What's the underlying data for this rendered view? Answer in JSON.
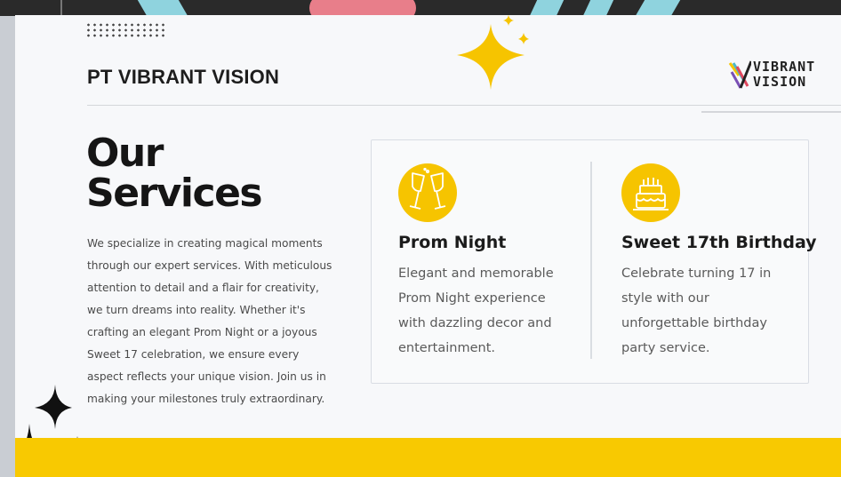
{
  "header": {
    "company": "PT VIBRANT VISION",
    "logo_line1": "VIBRANT",
    "logo_line2": "VISION"
  },
  "main": {
    "title_line1": "Our",
    "title_line2": "Services",
    "intro_lines": [
      "We specialize in creating magical moments",
      "through our expert services. With meticulous",
      "attention to detail and a flair for creativity,",
      "we turn dreams into reality. Whether it's",
      "crafting an elegant Prom Night or a joyous",
      "Sweet 17 celebration, we ensure every",
      "aspect reflects your unique vision. Join us in",
      "making your milestones truly extraordinary."
    ]
  },
  "services": [
    {
      "icon": "champagne-glasses-icon",
      "name": "Prom Night",
      "desc_lines": [
        "Elegant and memorable",
        "Prom Night experience",
        "with dazzling decor and",
        "entertainment."
      ]
    },
    {
      "icon": "birthday-cake-icon",
      "name": "Sweet 17th Birthday",
      "desc_lines": [
        "Celebrate turning 17 in",
        "style with our",
        "unforgettable birthday",
        "party service."
      ]
    }
  ],
  "colors": {
    "accent_yellow": "#f6c400",
    "footer_yellow": "#f8c901",
    "text_dark": "#1b1b1b",
    "text_body": "#4a4a4a"
  }
}
